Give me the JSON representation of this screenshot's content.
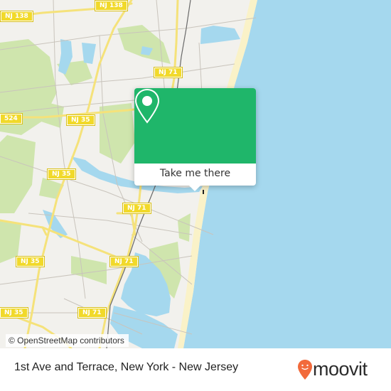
{
  "map": {
    "colors": {
      "land": "#f2f1ed",
      "water": "#a5d8ee",
      "park": "#cfe5ad",
      "beach": "#faf2c8",
      "road_major": "#f5e27a",
      "road_minor": "#c9c4bc",
      "rail": "#666666"
    },
    "road_labels": [
      {
        "id": "nj138-a",
        "text": "NJ 138"
      },
      {
        "id": "nj138-b",
        "text": "NJ 138"
      },
      {
        "id": "nj71-a",
        "text": "NJ 71"
      },
      {
        "id": "cr524",
        "text": "524"
      },
      {
        "id": "nj35-a",
        "text": "NJ 35"
      },
      {
        "id": "nj35-b",
        "text": "NJ 35"
      },
      {
        "id": "nj71-b",
        "text": "NJ 71"
      },
      {
        "id": "nj35-c",
        "text": "NJ 35"
      },
      {
        "id": "nj71-c",
        "text": "NJ 71"
      },
      {
        "id": "nj35-d",
        "text": "NJ 35"
      },
      {
        "id": "nj71-d",
        "text": "NJ 71"
      }
    ],
    "attribution": "© OpenStreetMap contributors"
  },
  "popup": {
    "icon": "map-pin-icon",
    "button_label": "Take me there",
    "color": "#1fb66a"
  },
  "footer": {
    "title": "1st Ave and Terrace, New York - New Jersey",
    "brand": "moovit",
    "brand_color": "#f26a3b"
  }
}
